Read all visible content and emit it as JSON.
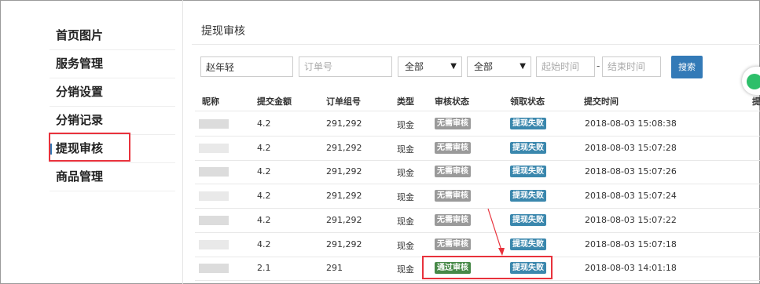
{
  "sidebar": {
    "items": [
      {
        "label": "首页图片"
      },
      {
        "label": "服务管理"
      },
      {
        "label": "分销设置"
      },
      {
        "label": "分销记录"
      },
      {
        "label": "提现审核",
        "active": true
      },
      {
        "label": "商品管理"
      }
    ]
  },
  "page": {
    "title": "提现审核"
  },
  "filters": {
    "nickname_value": "赵年轻",
    "order_placeholder": "订单号",
    "select1_value": "全部",
    "select2_value": "全部",
    "start_placeholder": "起始时间",
    "separator": "-",
    "end_placeholder": "结束时间",
    "search_label": "搜索"
  },
  "table": {
    "headers": [
      "昵称",
      "提交金额",
      "订单组号",
      "类型",
      "审核状态",
      "领取状态",
      "提交时间"
    ],
    "edge_header": "提",
    "rows": [
      {
        "amount": "4.2",
        "order": "291,292",
        "type": "现金",
        "audit": "无需审核",
        "audit_color": "#9a9a9a",
        "claim": "提现失败",
        "time": "2018-08-03 15:08:38"
      },
      {
        "amount": "4.2",
        "order": "291,292",
        "type": "现金",
        "audit": "无需审核",
        "audit_color": "#9a9a9a",
        "claim": "提现失败",
        "time": "2018-08-03 15:07:28"
      },
      {
        "amount": "4.2",
        "order": "291,292",
        "type": "现金",
        "audit": "无需审核",
        "audit_color": "#9a9a9a",
        "claim": "提现失败",
        "time": "2018-08-03 15:07:26"
      },
      {
        "amount": "4.2",
        "order": "291,292",
        "type": "现金",
        "audit": "无需审核",
        "audit_color": "#9a9a9a",
        "claim": "提现失败",
        "time": "2018-08-03 15:07:24"
      },
      {
        "amount": "4.2",
        "order": "291,292",
        "type": "现金",
        "audit": "无需审核",
        "audit_color": "#9a9a9a",
        "claim": "提现失败",
        "time": "2018-08-03 15:07:22"
      },
      {
        "amount": "4.2",
        "order": "291,292",
        "type": "现金",
        "audit": "无需审核",
        "audit_color": "#9a9a9a",
        "claim": "提现失败",
        "time": "2018-08-03 15:07:18"
      },
      {
        "amount": "2.1",
        "order": "291",
        "type": "现金",
        "audit": "通过审核",
        "audit_color": "#468847",
        "claim": "提现失败",
        "time": "2018-08-03 14:01:18"
      }
    ]
  },
  "colors": {
    "accent": "#337ab7",
    "annotation": "#e8323c",
    "claim_tag": "#3a87ad"
  }
}
